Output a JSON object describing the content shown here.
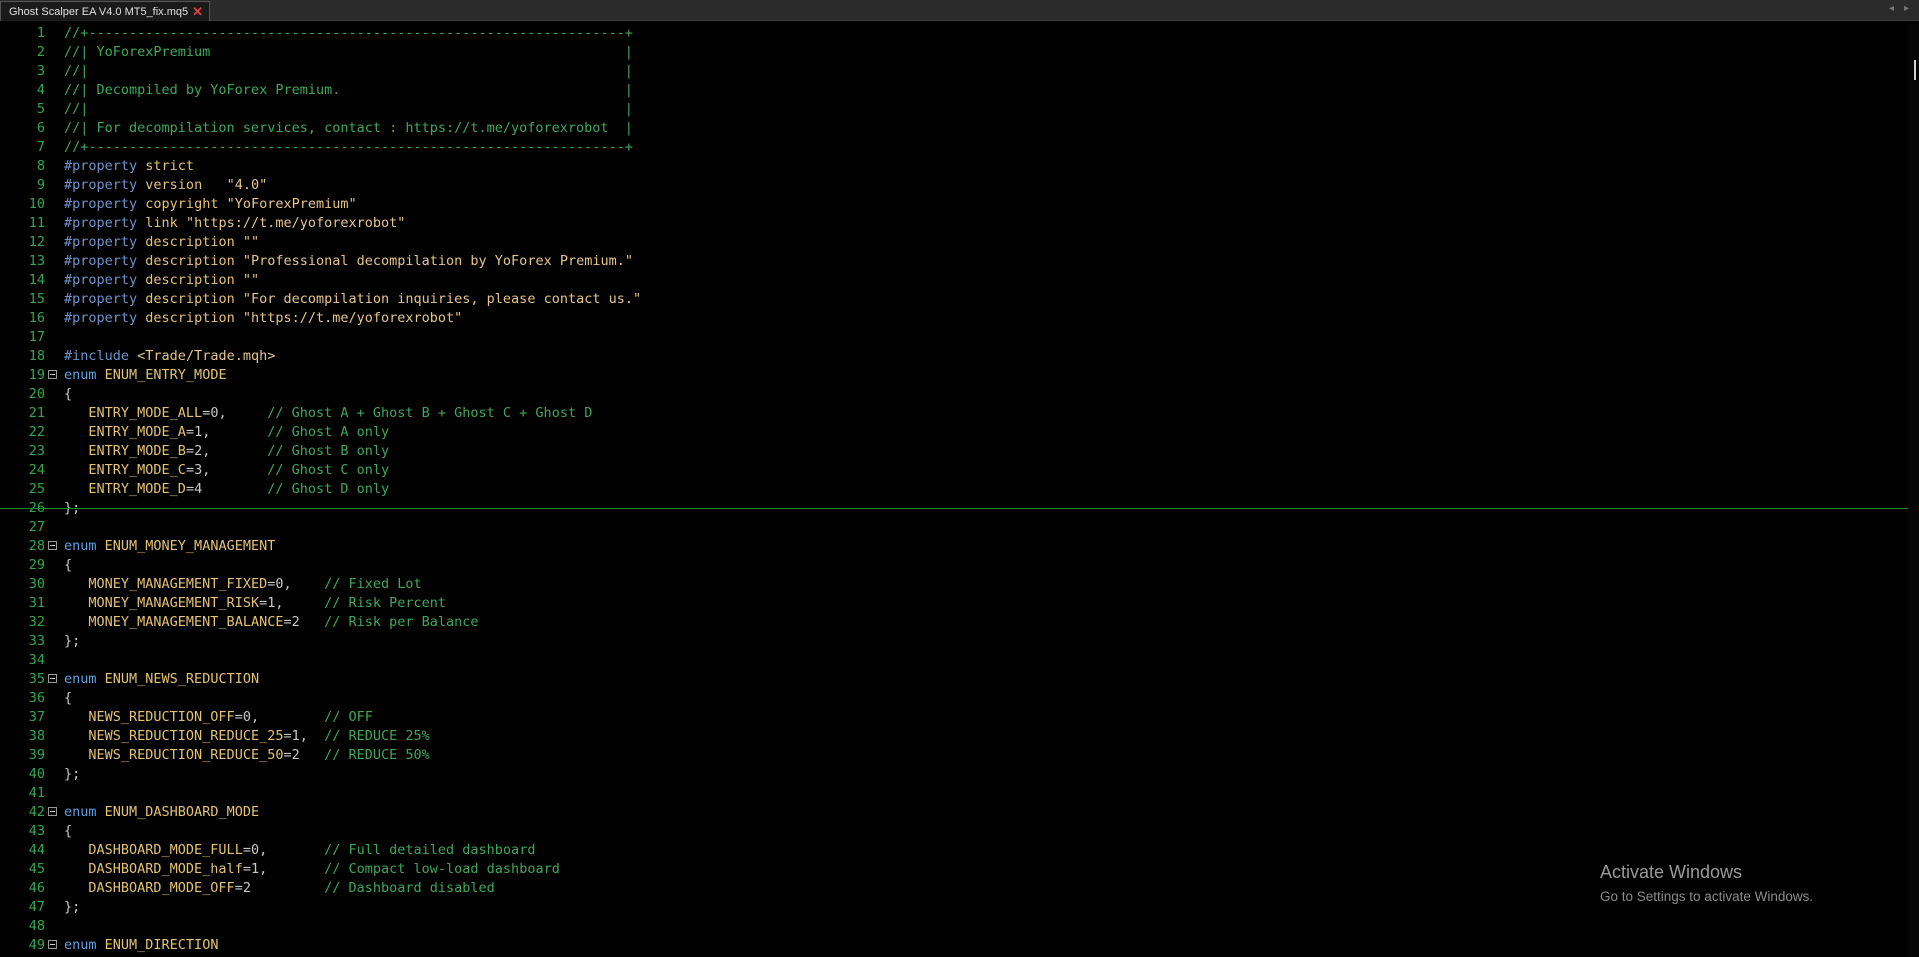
{
  "tab": {
    "title": "Ghost Scalper EA V4.0 MT5_fix.mq5",
    "close": "✕"
  },
  "nav": {
    "left": "◂",
    "right": "▸"
  },
  "lines": [
    {
      "n": "1",
      "tokens": [
        [
          "cm",
          "//+------------------------------------------------------------------+"
        ]
      ]
    },
    {
      "n": "2",
      "tokens": [
        [
          "cm",
          "//| YoForexPremium                                                   |"
        ]
      ]
    },
    {
      "n": "3",
      "tokens": [
        [
          "cm",
          "//|                                                                  |"
        ]
      ]
    },
    {
      "n": "4",
      "tokens": [
        [
          "cm",
          "//| Decompiled by YoForex Premium.                                   |"
        ]
      ]
    },
    {
      "n": "5",
      "tokens": [
        [
          "cm",
          "//|                                                                  |"
        ]
      ]
    },
    {
      "n": "6",
      "tokens": [
        [
          "cm",
          "//| For decompilation services, contact : https://t.me/yoforexrobot  |"
        ]
      ]
    },
    {
      "n": "7",
      "tokens": [
        [
          "cm",
          "//+------------------------------------------------------------------+"
        ]
      ]
    },
    {
      "n": "8",
      "tokens": [
        [
          "pp",
          "#property"
        ],
        [
          "tx",
          " "
        ],
        [
          "id",
          "strict"
        ]
      ]
    },
    {
      "n": "9",
      "tokens": [
        [
          "pp",
          "#property"
        ],
        [
          "tx",
          " "
        ],
        [
          "id",
          "version"
        ],
        [
          "tx",
          "   "
        ],
        [
          "str",
          "\"4.0\""
        ]
      ]
    },
    {
      "n": "10",
      "tokens": [
        [
          "pp",
          "#property"
        ],
        [
          "tx",
          " "
        ],
        [
          "id",
          "copyright"
        ],
        [
          "tx",
          " "
        ],
        [
          "str",
          "\"YoForexPremium\""
        ]
      ]
    },
    {
      "n": "11",
      "tokens": [
        [
          "pp",
          "#property"
        ],
        [
          "tx",
          " "
        ],
        [
          "id",
          "link"
        ],
        [
          "tx",
          " "
        ],
        [
          "str",
          "\"https://t.me/yoforexrobot\""
        ]
      ]
    },
    {
      "n": "12",
      "tokens": [
        [
          "pp",
          "#property"
        ],
        [
          "tx",
          " "
        ],
        [
          "id",
          "description"
        ],
        [
          "tx",
          " "
        ],
        [
          "str",
          "\"\""
        ]
      ]
    },
    {
      "n": "13",
      "tokens": [
        [
          "pp",
          "#property"
        ],
        [
          "tx",
          " "
        ],
        [
          "id",
          "description"
        ],
        [
          "tx",
          " "
        ],
        [
          "str",
          "\"Professional decompilation by YoForex Premium.\""
        ]
      ]
    },
    {
      "n": "14",
      "tokens": [
        [
          "pp",
          "#property"
        ],
        [
          "tx",
          " "
        ],
        [
          "id",
          "description"
        ],
        [
          "tx",
          " "
        ],
        [
          "str",
          "\"\""
        ]
      ]
    },
    {
      "n": "15",
      "tokens": [
        [
          "pp",
          "#property"
        ],
        [
          "tx",
          " "
        ],
        [
          "id",
          "description"
        ],
        [
          "tx",
          " "
        ],
        [
          "str",
          "\"For decompilation inquiries, please contact us.\""
        ]
      ]
    },
    {
      "n": "16",
      "tokens": [
        [
          "pp",
          "#property"
        ],
        [
          "tx",
          " "
        ],
        [
          "id",
          "description"
        ],
        [
          "tx",
          " "
        ],
        [
          "str",
          "\"https://t.me/yoforexrobot\""
        ]
      ]
    },
    {
      "n": "17",
      "tokens": []
    },
    {
      "n": "18",
      "tokens": [
        [
          "pp",
          "#include"
        ],
        [
          "tx",
          " "
        ],
        [
          "str",
          "<Trade/Trade.mqh>"
        ]
      ]
    },
    {
      "n": "19",
      "fold": true,
      "tokens": [
        [
          "kw",
          "enum"
        ],
        [
          "tx",
          " "
        ],
        [
          "id",
          "ENUM_ENTRY_MODE"
        ]
      ]
    },
    {
      "n": "20",
      "tokens": [
        [
          "pn",
          "{"
        ]
      ]
    },
    {
      "n": "21",
      "tokens": [
        [
          "tx",
          "   "
        ],
        [
          "id",
          "ENTRY_MODE_ALL"
        ],
        [
          "pn",
          "=0,"
        ],
        [
          "tx",
          "     "
        ],
        [
          "cm",
          "// Ghost A + Ghost B + Ghost C + Ghost D"
        ]
      ]
    },
    {
      "n": "22",
      "tokens": [
        [
          "tx",
          "   "
        ],
        [
          "id",
          "ENTRY_MODE_A"
        ],
        [
          "pn",
          "=1,"
        ],
        [
          "tx",
          "       "
        ],
        [
          "cm",
          "// Ghost A only"
        ]
      ]
    },
    {
      "n": "23",
      "tokens": [
        [
          "tx",
          "   "
        ],
        [
          "id",
          "ENTRY_MODE_B"
        ],
        [
          "pn",
          "=2,"
        ],
        [
          "tx",
          "       "
        ],
        [
          "cm",
          "// Ghost B only"
        ]
      ]
    },
    {
      "n": "24",
      "tokens": [
        [
          "tx",
          "   "
        ],
        [
          "id",
          "ENTRY_MODE_C"
        ],
        [
          "pn",
          "=3,"
        ],
        [
          "tx",
          "       "
        ],
        [
          "cm",
          "// Ghost C only"
        ]
      ]
    },
    {
      "n": "25",
      "tokens": [
        [
          "tx",
          "   "
        ],
        [
          "id",
          "ENTRY_MODE_D"
        ],
        [
          "pn",
          "=4"
        ],
        [
          "tx",
          "        "
        ],
        [
          "cm",
          "// Ghost D only"
        ]
      ]
    },
    {
      "n": "26",
      "tokens": [
        [
          "pn",
          "};"
        ]
      ]
    },
    {
      "n": "27",
      "tokens": []
    },
    {
      "n": "28",
      "fold": true,
      "tokens": [
        [
          "kw",
          "enum"
        ],
        [
          "tx",
          " "
        ],
        [
          "id",
          "ENUM_MONEY_MANAGEMENT"
        ]
      ]
    },
    {
      "n": "29",
      "tokens": [
        [
          "pn",
          "{"
        ]
      ]
    },
    {
      "n": "30",
      "tokens": [
        [
          "tx",
          "   "
        ],
        [
          "id",
          "MONEY_MANAGEMENT_FIXED"
        ],
        [
          "pn",
          "=0,"
        ],
        [
          "tx",
          "    "
        ],
        [
          "cm",
          "// Fixed Lot"
        ]
      ]
    },
    {
      "n": "31",
      "tokens": [
        [
          "tx",
          "   "
        ],
        [
          "id",
          "MONEY_MANAGEMENT_RISK"
        ],
        [
          "pn",
          "=1,"
        ],
        [
          "tx",
          "     "
        ],
        [
          "cm",
          "// Risk Percent"
        ]
      ]
    },
    {
      "n": "32",
      "tokens": [
        [
          "tx",
          "   "
        ],
        [
          "id",
          "MONEY_MANAGEMENT_BALANCE"
        ],
        [
          "pn",
          "=2"
        ],
        [
          "tx",
          "   "
        ],
        [
          "cm",
          "// Risk per Balance"
        ]
      ]
    },
    {
      "n": "33",
      "tokens": [
        [
          "pn",
          "};"
        ]
      ]
    },
    {
      "n": "34",
      "tokens": []
    },
    {
      "n": "35",
      "fold": true,
      "tokens": [
        [
          "kw",
          "enum"
        ],
        [
          "tx",
          " "
        ],
        [
          "id",
          "ENUM_NEWS_REDUCTION"
        ]
      ]
    },
    {
      "n": "36",
      "tokens": [
        [
          "pn",
          "{"
        ]
      ]
    },
    {
      "n": "37",
      "tokens": [
        [
          "tx",
          "   "
        ],
        [
          "id",
          "NEWS_REDUCTION_OFF"
        ],
        [
          "pn",
          "=0,"
        ],
        [
          "tx",
          "        "
        ],
        [
          "cm",
          "// OFF"
        ]
      ]
    },
    {
      "n": "38",
      "tokens": [
        [
          "tx",
          "   "
        ],
        [
          "id",
          "NEWS_REDUCTION_REDUCE_25"
        ],
        [
          "pn",
          "=1,"
        ],
        [
          "tx",
          "  "
        ],
        [
          "cm",
          "// REDUCE 25%"
        ]
      ]
    },
    {
      "n": "39",
      "tokens": [
        [
          "tx",
          "   "
        ],
        [
          "id",
          "NEWS_REDUCTION_REDUCE_50"
        ],
        [
          "pn",
          "=2"
        ],
        [
          "tx",
          "   "
        ],
        [
          "cm",
          "// REDUCE 50%"
        ]
      ]
    },
    {
      "n": "40",
      "tokens": [
        [
          "pn",
          "};"
        ]
      ]
    },
    {
      "n": "41",
      "tokens": []
    },
    {
      "n": "42",
      "fold": true,
      "tokens": [
        [
          "kw",
          "enum"
        ],
        [
          "tx",
          " "
        ],
        [
          "id",
          "ENUM_DASHBOARD_MODE"
        ]
      ]
    },
    {
      "n": "43",
      "tokens": [
        [
          "pn",
          "{"
        ]
      ]
    },
    {
      "n": "44",
      "tokens": [
        [
          "tx",
          "   "
        ],
        [
          "id",
          "DASHBOARD_MODE_FULL"
        ],
        [
          "pn",
          "=0,"
        ],
        [
          "tx",
          "       "
        ],
        [
          "cm",
          "// Full detailed dashboard"
        ]
      ]
    },
    {
      "n": "45",
      "tokens": [
        [
          "tx",
          "   "
        ],
        [
          "id",
          "DASHBOARD_MODE_half"
        ],
        [
          "pn",
          "=1,"
        ],
        [
          "tx",
          "       "
        ],
        [
          "cm",
          "// Compact low-load dashboard"
        ]
      ]
    },
    {
      "n": "46",
      "tokens": [
        [
          "tx",
          "   "
        ],
        [
          "id",
          "DASHBOARD_MODE_OFF"
        ],
        [
          "pn",
          "=2"
        ],
        [
          "tx",
          "         "
        ],
        [
          "cm",
          "// Dashboard disabled"
        ]
      ]
    },
    {
      "n": "47",
      "tokens": [
        [
          "pn",
          "};"
        ]
      ]
    },
    {
      "n": "48",
      "tokens": []
    },
    {
      "n": "49",
      "fold": true,
      "tokens": [
        [
          "kw",
          "enum"
        ],
        [
          "tx",
          " "
        ],
        [
          "id",
          "ENUM_DIRECTION"
        ]
      ]
    }
  ],
  "watermark": {
    "line1": "Activate Windows",
    "line2": "Go to Settings to activate Windows."
  }
}
